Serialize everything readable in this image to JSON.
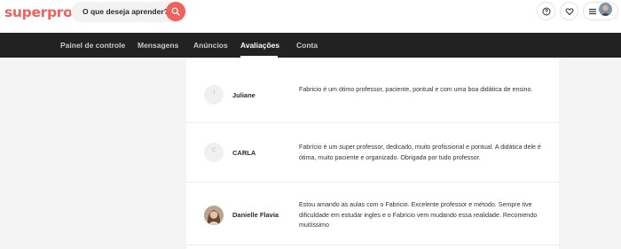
{
  "header": {
    "logo": "superprof",
    "search_label": "O que deseja aprender?",
    "icons": [
      "search-icon",
      "help-icon",
      "heart-icon",
      "menu-icon"
    ],
    "brand_color": "#f0605d"
  },
  "nav": {
    "items": [
      {
        "label": "Painel de controle"
      },
      {
        "label": "Mensagens"
      },
      {
        "label": "Anúncios"
      },
      {
        "label": "Avaliações",
        "active": true
      },
      {
        "label": "Conta"
      }
    ]
  },
  "reviews": [
    {
      "name": "Juliane",
      "initial": "J",
      "text": "Fabricio é um ótimo professor, paciente, pontual e com uma boa didática de ensino."
    },
    {
      "name": "CARLA",
      "initial": "C",
      "text": "Fabrício é um super professor, dedicado, muito profissional e pontual. A didática dele é ótima, muito paciente e organizado. Obrigada por tudo professor."
    },
    {
      "name": "Danielle Flavia",
      "text": "Estou amando as aulas com o Fabricio. Excelente professor e método. Sempre tive dificuldade em estudar ingles e o Fabricio vem mudando essa realidade. Recomendo muitíssimo"
    }
  ]
}
